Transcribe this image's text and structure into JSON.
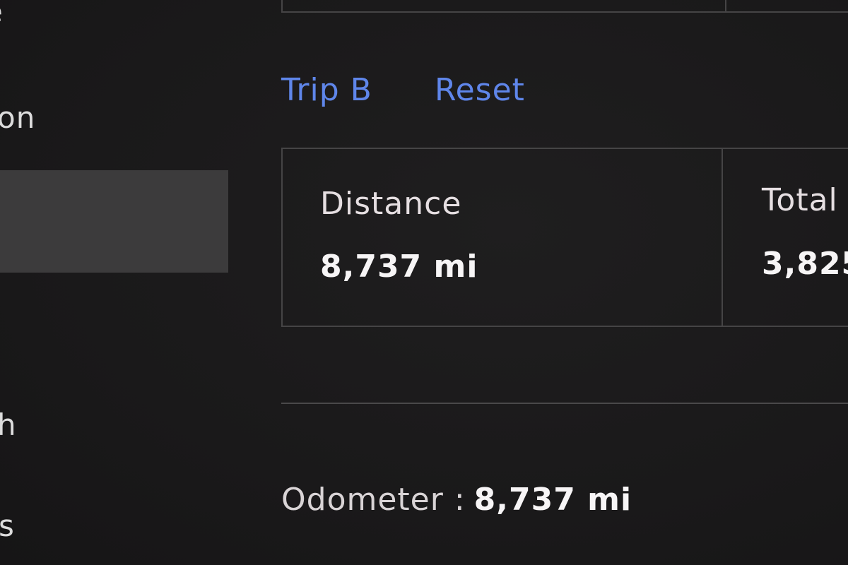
{
  "sidebar": {
    "items": [
      {
        "label": "e"
      },
      {
        "label": "on"
      },
      {
        "label": ""
      },
      {
        "label": "h"
      },
      {
        "label": "s"
      }
    ]
  },
  "trip": {
    "title": "Trip B",
    "reset_label": "Reset"
  },
  "stats": {
    "distance_label": "Distance",
    "distance_value": "8,737 mi",
    "total_label": "Total",
    "total_value": "3,825"
  },
  "odometer": {
    "label": "Odometer :",
    "value": "8,737 mi"
  },
  "colors": {
    "background": "#1a1919",
    "accent": "#5f86ea",
    "selected_item": "#3c3b3c",
    "border": "#454445"
  }
}
